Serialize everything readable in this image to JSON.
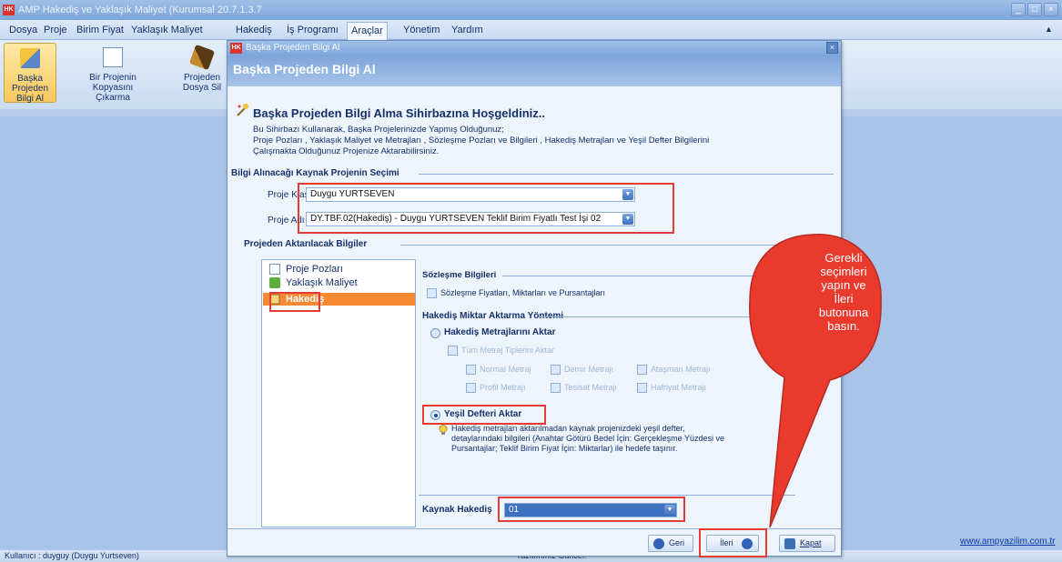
{
  "app": {
    "title": "AMP Hakediş ve Yaklaşık Maliyet (Kurumsal 20.7.1.3.7"
  },
  "menus": [
    "Dosya",
    "Proje",
    "Birim Fiyat",
    "Yaklaşık Maliyet",
    "Hakediş",
    "İş Programı",
    "Araçlar",
    "Yönetim",
    "Yardım"
  ],
  "ribbon": [
    {
      "line1": "Başka Projeden",
      "line2": "Bilgi Al"
    },
    {
      "line1": "Bir Projenin",
      "line2": "Kopyasını Çıkarma"
    },
    {
      "line1": "Projeden",
      "line2": "Dosya Sil"
    }
  ],
  "status": {
    "user": "Kullanıcı : duyguy  (Duygu Yurtseven)",
    "website": "www.ampyazilim.com.tr",
    "partial": "Yazılımınız Güncel."
  },
  "dialog": {
    "title": "Başka Projeden Bilgi Al",
    "header": "Başka Projeden Bilgi Al",
    "welcome": "Başka Projeden Bilgi Alma Sihirbazına Hoşgeldiniz..",
    "desc1": "Bu Sihirbazı Kullanarak, Başka Projelerinizde Yapmış Olduğunuz;",
    "desc2": "Proje Pozları , Yaklaşık Maliyet ve Metrajları , Sözleşme Pozları ve Bilgileri , Hakediş Metrajları  ve Yeşil Defter Bilgilerini",
    "desc3": "Çalışmakta Olduğunuz Projenize Aktarabilirsiniz.",
    "section1": "Bilgi Alınacağı Kaynak Projenin Seçimi",
    "folder_label": "Proje Klasörü",
    "folder_value": "Duygu YURTSEVEN",
    "project_label": "Proje Adı",
    "project_value": "DY.TBF.02(Hakediş) - Duygu YURTSEVEN Teklif Birim Fiyatlı Test İşi 02",
    "section2": "Projeden Aktarılacak Bilgiler",
    "tree": [
      "Proje Pozları",
      "Yaklaşık Maliyet",
      "Hakediş"
    ],
    "contract_title": "Sözleşme Bilgileri",
    "contract_chk": "Sözleşme Fiyatları, Miktarları ve Pursantajları",
    "method_title": "Hakediş Miktar Aktarma Yöntemi",
    "radio1": "Hakediş Metrajlarını Aktar",
    "all_types": "Tüm Metraj Tiplerini Aktar",
    "types": [
      "Normal Metraj",
      "Demir Metrajı",
      "Ataşman Metrajı",
      "Profil Metrajı",
      "Tesisat Metrajı",
      "Hafriyat Metrajı"
    ],
    "radio2": "Yeşil Defteri Aktar",
    "note1": "Hakediş metrajları aktarılmadan kaynak projenizdeki yeşil defter,",
    "note2": "detaylarındaki bilgileri (Anahtar Götürü Bedel İçin: Gerçekleşme Yüzdesi ve",
    "note3": "Pursantajlar;  Teklif Birim Fiyat İçin: Miktarlar)  ile hedefe taşınır.",
    "source_label": "Kaynak Hakediş",
    "source_value": "01",
    "back": "Geri",
    "next": "İleri",
    "close": "Kapat"
  },
  "callout": {
    "l1": "Gerekli",
    "l2": "seçimleri",
    "l3": "yapın ve",
    "l4": "İleri",
    "l5": "butonuna",
    "l6": "basın."
  },
  "colors": {
    "highlight": "#e23c34",
    "selection": "#f58a33",
    "callout": "#ea3a2e"
  }
}
